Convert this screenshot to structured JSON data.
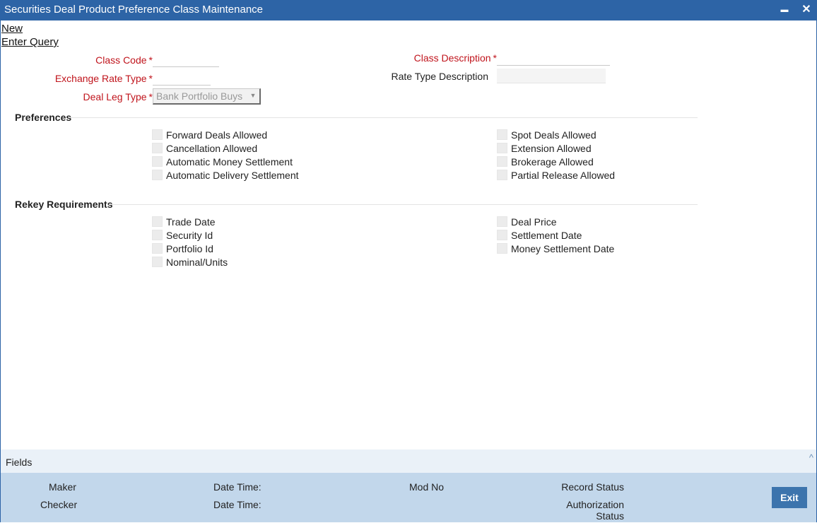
{
  "window": {
    "title": "Securities Deal Product Preference Class Maintenance",
    "minimize_glyph": "▬",
    "close_glyph": "✕"
  },
  "toolbar": {
    "new_label": "New",
    "enter_query_label": "Enter Query"
  },
  "form": {
    "class_code_label": "Class Code",
    "class_code_value": "",
    "exchange_rate_type_label": "Exchange Rate Type",
    "exchange_rate_type_value": "",
    "deal_leg_type_label": "Deal Leg Type",
    "deal_leg_type_value": "Bank Portfolio Buys",
    "class_description_label": "Class Description",
    "class_description_value": "",
    "rate_type_description_label": "Rate Type Description",
    "rate_type_description_value": "",
    "required_marker": "*"
  },
  "preferences": {
    "title": "Preferences",
    "left": [
      {
        "label": "Forward Deals Allowed",
        "checked": false
      },
      {
        "label": "Cancellation Allowed",
        "checked": false
      },
      {
        "label": "Automatic Money Settlement",
        "checked": false
      },
      {
        "label": "Automatic Delivery Settlement",
        "checked": false
      }
    ],
    "right": [
      {
        "label": "Spot Deals Allowed",
        "checked": false
      },
      {
        "label": "Extension Allowed",
        "checked": false
      },
      {
        "label": "Brokerage Allowed",
        "checked": false
      },
      {
        "label": "Partial Release Allowed",
        "checked": false
      }
    ]
  },
  "rekey": {
    "title": "Rekey Requirements",
    "left": [
      {
        "label": "Trade Date",
        "checked": false
      },
      {
        "label": "Security Id",
        "checked": false
      },
      {
        "label": "Portfolio Id",
        "checked": false
      },
      {
        "label": "Nominal/Units",
        "checked": false
      }
    ],
    "right": [
      {
        "label": "Deal Price",
        "checked": false
      },
      {
        "label": "Settlement Date",
        "checked": false
      },
      {
        "label": "Money Settlement Date",
        "checked": false
      }
    ]
  },
  "fields_bar": {
    "label": "Fields",
    "collapse_glyph": "^"
  },
  "footer": {
    "maker_label": "Maker",
    "checker_label": "Checker",
    "date_time_label_1": "Date Time:",
    "date_time_label_2": "Date Time:",
    "mod_no_label": "Mod No",
    "record_status_label": "Record Status",
    "authorization_label_line1": "Authorization",
    "authorization_label_line2": "Status",
    "exit_label": "Exit"
  },
  "colors": {
    "titlebar": "#2d64a6",
    "required": "#c0141c",
    "footer": "#c2d7eb",
    "exit_button": "#3c74ad"
  }
}
